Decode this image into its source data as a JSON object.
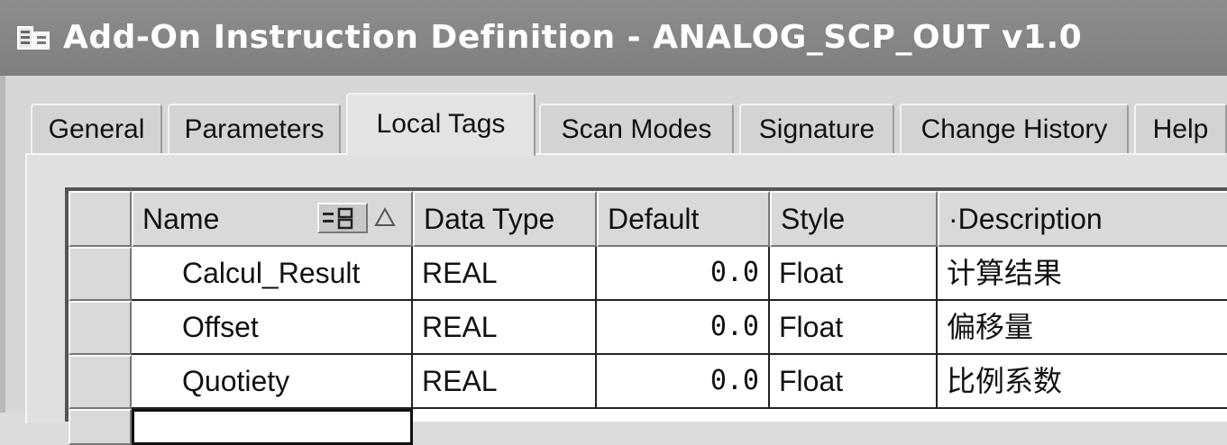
{
  "window": {
    "title": "Add-On Instruction Definition - ANALOG_SCP_OUT v1.0",
    "icon": "aoi-definition-icon"
  },
  "tabs": [
    {
      "label": "General",
      "active": false
    },
    {
      "label": "Parameters",
      "active": false
    },
    {
      "label": "Local Tags",
      "active": true
    },
    {
      "label": "Scan Modes",
      "active": false
    },
    {
      "label": "Signature",
      "active": false
    },
    {
      "label": "Change History",
      "active": false
    },
    {
      "label": "Help",
      "active": false
    }
  ],
  "grid": {
    "columns": [
      "Name",
      "Data Type",
      "Default",
      "Style",
      "·Description"
    ],
    "sort_column": "Name",
    "sort_direction": "ascending",
    "rows": [
      {
        "name": "Calcul_Result",
        "data_type": "REAL",
        "default": "0.0",
        "style": "Float",
        "description": "计算结果"
      },
      {
        "name": "Offset",
        "data_type": "REAL",
        "default": "0.0",
        "style": "Float",
        "description": "偏移量"
      },
      {
        "name": "Quotiety",
        "data_type": "REAL",
        "default": "0.0",
        "style": "Float",
        "description": "比例系数"
      }
    ]
  }
}
